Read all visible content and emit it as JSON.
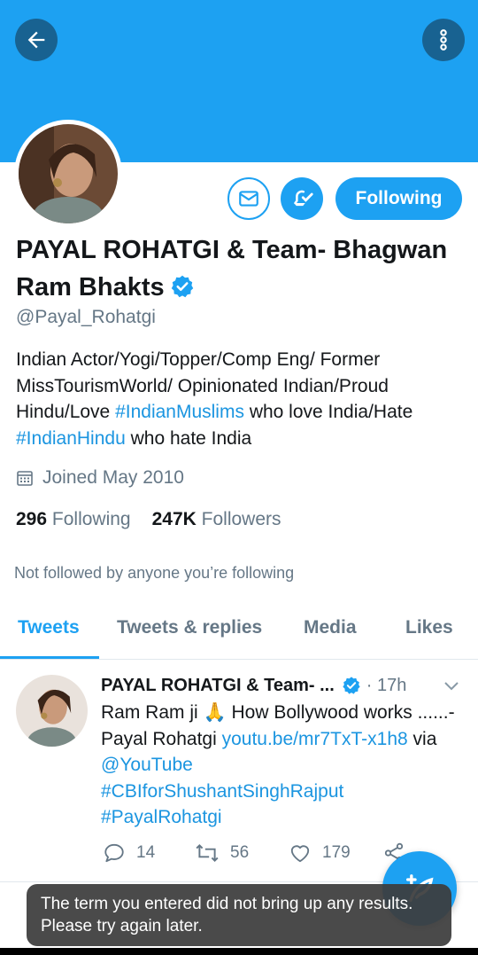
{
  "colors": {
    "accent": "#1da1f2",
    "link": "#1b95e0",
    "muted": "#657786"
  },
  "header": {
    "back_icon": "arrow-left-icon",
    "more_icon": "more-vertical-icon"
  },
  "profile": {
    "name": "PAYAL ROHATGI & Team- Bhagwan Ram Bhakts",
    "handle": "@Payal_Rohatgi",
    "bio_parts": [
      "Indian Actor/Yogi/Topper/Comp Eng/ Former MissTourismWorld/ Opinionated Indian/Proud Hindu/Love ",
      "#IndianMuslims",
      " who love India/Hate ",
      "#IndianHindu",
      " who hate India"
    ],
    "joined": "Joined May 2010",
    "following_count": "296",
    "following_label": "Following",
    "followers_count": "247K",
    "followers_label": "Followers",
    "not_followed_note": "Not followed by anyone you’re following"
  },
  "actions": {
    "following_button": "Following"
  },
  "tabs": [
    {
      "label": "Tweets",
      "active": true
    },
    {
      "label": "Tweets & replies",
      "active": false
    },
    {
      "label": "Media",
      "active": false
    },
    {
      "label": "Likes",
      "active": false
    }
  ],
  "tweet": {
    "author": "PAYAL ROHATGI & Team- ...",
    "time": "· 17h",
    "text_plain": "Ram Ram ji 🙏 How Bollywood works ......- Payal Rohatgi ",
    "link": "youtu.be/mr7TxT-x1h8",
    "via": " via ",
    "mention": "@YouTube",
    "hashtag1": "#CBIforShushantSinghRajput",
    "hashtag2": "#PayalRohatgi",
    "replies": "14",
    "retweets": "56",
    "likes": "179"
  },
  "toast": {
    "message": "The term you entered did not bring up any results. Please try again later."
  }
}
